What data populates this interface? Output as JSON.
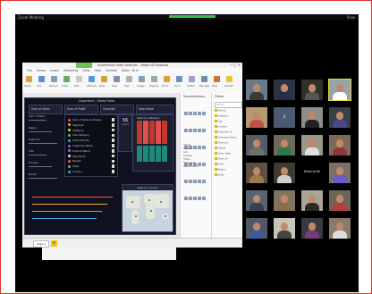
{
  "zoom": {
    "top_left": "Zoom Meeting",
    "top_right": "View"
  },
  "pbi": {
    "title": "Superstore Sales Analysis - Power BI Desktop",
    "menus": [
      "File",
      "Home",
      "Insert",
      "Modeling",
      "View",
      "Help",
      "Format",
      "Data / Drill"
    ],
    "ribbon": [
      "Paste",
      "Get Data",
      "Recent Sources",
      "Enter Data",
      "Edit Queries",
      "Refresh",
      "New Page",
      "New Visual",
      "Text box",
      "Image",
      "Shapes",
      "From Marketplace",
      "From File",
      "Switch Theme",
      "Manage Relationships",
      "New Measure",
      "Publish"
    ],
    "report_title": "Superstore - Global Sales",
    "kpis": [
      "Sum of Sales",
      "Sum of Profit",
      "Quantity",
      "Ship Mode"
    ],
    "legend": [
      {
        "label": "Sum of Sales by Region",
        "color": "#f05a5a"
      },
      {
        "label": "Segment",
        "color": "#f2a33a"
      },
      {
        "label": "Category",
        "color": "#e2d43a"
      },
      {
        "label": "Sub-Category",
        "color": "#5fc46a"
      },
      {
        "label": "Order Priority",
        "color": "#3aa5e0"
      },
      {
        "label": "Customer Name",
        "color": "#7a6ae0"
      },
      {
        "label": "Product Name",
        "color": "#d45ad0"
      },
      {
        "label": "Ship Mode",
        "color": "#e0e0e0"
      },
      {
        "label": "Market",
        "color": "#f05a5a"
      },
      {
        "label": "State",
        "color": "#5fc46a"
      },
      {
        "label": "Country",
        "color": "#3aa5e0"
      }
    ],
    "left_labels": [
      "Sum of Sales",
      "Region",
      "Segment",
      "Year",
      "Quarter",
      "Month"
    ],
    "card": {
      "value": "56",
      "label": "Count"
    },
    "bars_title": "Sales by Category",
    "map_title": "Sales by Country",
    "page_tab": "Page 1",
    "page_add": "+"
  },
  "visualizations": {
    "title": "Visualizations",
    "values": [
      "Values",
      "Legend",
      "Axis",
      "Tooltips",
      "Filters",
      "Page level",
      "Report level"
    ]
  },
  "fields": {
    "title": "Fields",
    "search_placeholder": "Search",
    "items": [
      "Orders",
      "Category",
      "City",
      "Country",
      "Customer ID",
      "Customer Name",
      "Discount",
      "Market",
      "Order Date",
      "Order ID",
      "Profit",
      "Region",
      "Sales"
    ]
  },
  "participants": [
    {
      "name": "",
      "shirt": "#3a3a3a",
      "bg": "#6b7a88"
    },
    {
      "name": "",
      "shirt": "#2a2a4a",
      "bg": "#2d3340"
    },
    {
      "name": "",
      "shirt": "#555555",
      "bg": "#30302a"
    },
    {
      "name": "",
      "shirt": "#ffffff",
      "bg": "#9aa3a8",
      "active": true
    },
    {
      "name": "",
      "shirt": "#c0504d",
      "bg": "#b59a6e"
    },
    {
      "name": "",
      "shirt": "#3a6ea5",
      "bg": "#4a5a70",
      "text": "S"
    },
    {
      "name": "",
      "shirt": "#222222",
      "bg": "#8e8e88"
    },
    {
      "name": "",
      "shirt": "#4a4a8a",
      "bg": "#3b3f48"
    },
    {
      "name": "",
      "shirt": "#707070",
      "bg": "#585c66"
    },
    {
      "name": "",
      "shirt": "#2b7a4b",
      "bg": "#6f6a5a"
    },
    {
      "name": "",
      "shirt": "#e0e0e0",
      "bg": "#9a9688"
    },
    {
      "name": "",
      "shirt": "#8a3a3a",
      "bg": "#7d6b5a"
    },
    {
      "name": "",
      "shirt": "#a07850",
      "bg": "#5d5040"
    },
    {
      "name": "",
      "shirt": "#d0d0d0",
      "bg": "#403a35"
    },
    {
      "name": "",
      "shirt": "#000000",
      "bg": "#000000",
      "text": "Dhanraj Pal"
    },
    {
      "name": "",
      "shirt": "#6a5acd",
      "bg": "#7a7068"
    },
    {
      "name": "",
      "shirt": "#334455",
      "bg": "#5a6470"
    },
    {
      "name": "",
      "shirt": "#8b6f47",
      "bg": "#807560"
    },
    {
      "name": "",
      "shirt": "#2a2a2a",
      "bg": "#a8a498"
    },
    {
      "name": "",
      "shirt": "#b04040",
      "bg": "#6e6458"
    },
    {
      "name": "",
      "shirt": "#3a5a9a",
      "bg": "#505868"
    },
    {
      "name": "",
      "shirt": "#444444",
      "bg": "#c8c4b8"
    },
    {
      "name": "",
      "shirt": "#7a3a7a",
      "bg": "#3a3840"
    },
    {
      "name": "",
      "shirt": "#dddddd",
      "bg": "#8a7a6a"
    }
  ]
}
